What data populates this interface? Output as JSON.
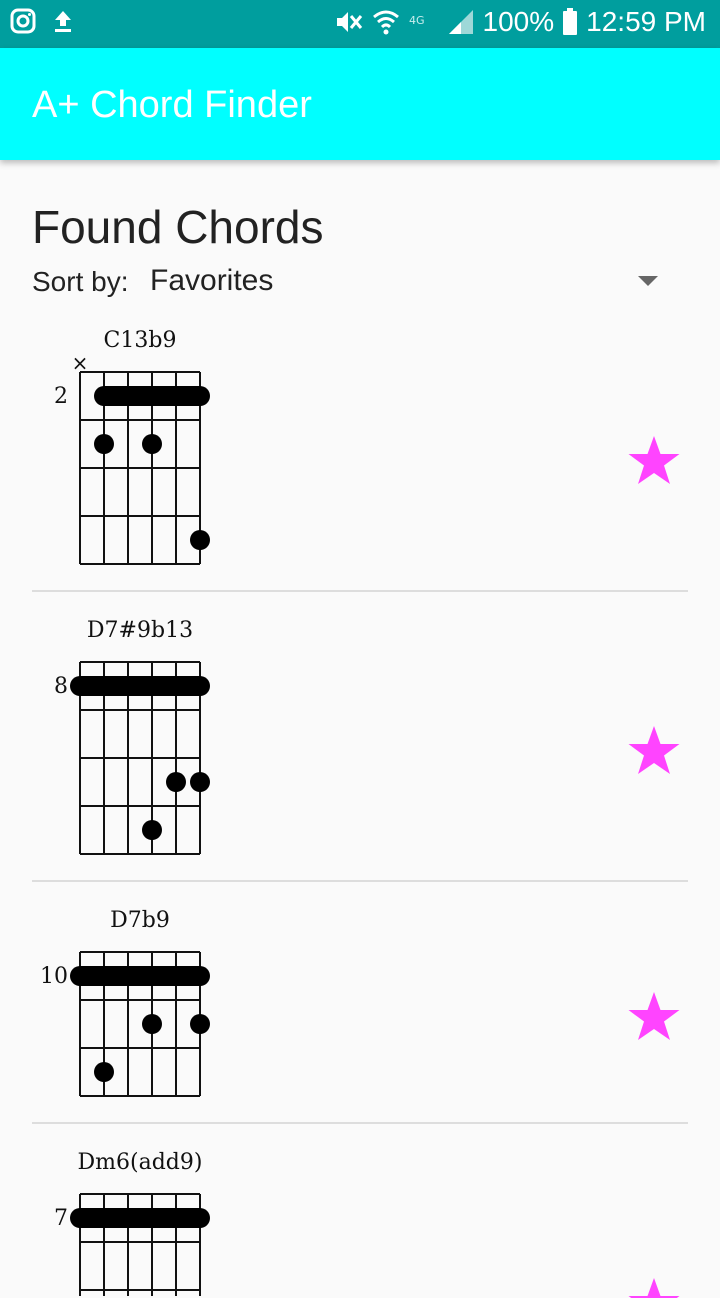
{
  "status_bar": {
    "left_icons": [
      "instagram-icon",
      "upload-icon"
    ],
    "right_icons": [
      "mute-icon",
      "wifi-icon",
      "4g-icon",
      "signal-icon",
      "battery-icon"
    ],
    "battery": "100%",
    "time": "12:59 PM"
  },
  "app_bar": {
    "title": "A+ Chord Finder",
    "color": "#00ffff"
  },
  "main": {
    "title": "Found Chords",
    "sort_label": "Sort by:",
    "sort_value": "Favorites"
  },
  "chords": [
    {
      "name": "C13b9",
      "fret": "2",
      "muted": [
        1
      ],
      "barre": {
        "from": 2,
        "to": 6,
        "fret_row": 1
      },
      "dots": [
        {
          "string": 2,
          "row": 2
        },
        {
          "string": 4,
          "row": 2
        },
        {
          "string": 6,
          "row": 4
        }
      ],
      "favorite": true
    },
    {
      "name": "D7#9b13",
      "fret": "8",
      "muted": [],
      "barre": {
        "from": 1,
        "to": 6,
        "fret_row": 1
      },
      "dots": [
        {
          "string": 5,
          "row": 3
        },
        {
          "string": 6,
          "row": 3
        },
        {
          "string": 4,
          "row": 4
        }
      ],
      "favorite": true
    },
    {
      "name": "D7b9",
      "fret": "10",
      "muted": [],
      "barre": {
        "from": 1,
        "to": 6,
        "fret_row": 1
      },
      "dots": [
        {
          "string": 4,
          "row": 2
        },
        {
          "string": 6,
          "row": 2
        },
        {
          "string": 2,
          "row": 3
        }
      ],
      "favorite": true
    },
    {
      "name": "Dm6(add9)",
      "fret": "7",
      "muted": [],
      "barre": {
        "from": 1,
        "to": 6,
        "fret_row": 1
      },
      "dots": [],
      "favorite": true
    }
  ],
  "colors": {
    "star": "#ff44ff",
    "status_bar": "#009e9e"
  }
}
